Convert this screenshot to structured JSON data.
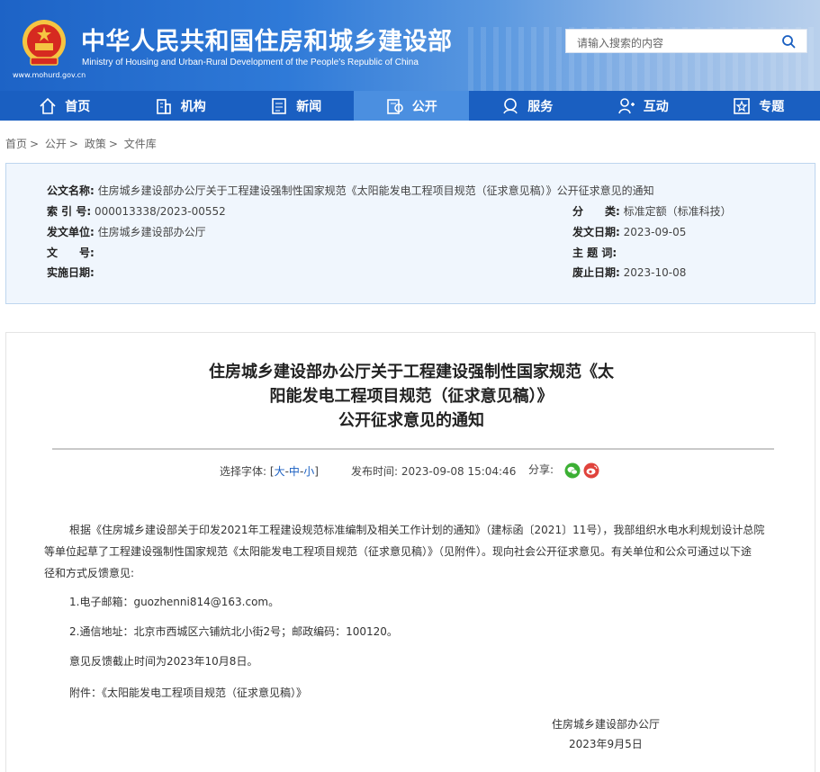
{
  "header": {
    "site_title": "中华人民共和国住房和城乡建设部",
    "site_subtitle": "Ministry of Housing and Urban-Rural Development of the People’s Republic of China",
    "site_url": "www.mohurd.gov.cn",
    "search_placeholder": "请输入搜索的内容"
  },
  "nav": {
    "items": [
      {
        "label": "首页",
        "icon": "home-icon"
      },
      {
        "label": "机构",
        "icon": "building-icon"
      },
      {
        "label": "新闻",
        "icon": "news-icon"
      },
      {
        "label": "公开",
        "icon": "open-icon"
      },
      {
        "label": "服务",
        "icon": "service-icon"
      },
      {
        "label": "互动",
        "icon": "interact-icon"
      },
      {
        "label": "专题",
        "icon": "topic-icon"
      }
    ],
    "active": "公开"
  },
  "breadcrumb": [
    "首页",
    "公开",
    "政策",
    "文件库"
  ],
  "meta": {
    "doc_name_label": "公文名称:",
    "doc_name": "住房城乡建设部办公厅关于工程建设强制性国家规范《太阳能发电工程项目规范（征求意见稿）》公开征求意见的通知",
    "index_label": "索 引 号:",
    "index": "000013338/2023-00552",
    "category_label": "分　　类:",
    "category": "标准定额（标准科技）",
    "issuer_label": "发文单位:",
    "issuer": "住房城乡建设部办公厅",
    "issue_date_label": "发文日期:",
    "issue_date": "2023-09-05",
    "doc_no_label": "文　　号:",
    "doc_no": "",
    "keywords_label": "主 题 词:",
    "keywords": "",
    "effective_label": "实施日期:",
    "effective": "",
    "expire_label": "废止日期:",
    "expire": "2023-10-08"
  },
  "article": {
    "title_lines": [
      "住房城乡建设部办公厅关于工程建设强制性国家规范《太",
      "阳能发电工程项目规范（征求意见稿）》",
      "公开征求意见的通知"
    ],
    "font_select_label": "选择字体:",
    "font_open": "[",
    "font_large": "大",
    "font_medium": "中",
    "font_small": "小",
    "font_sep": "-",
    "font_close": "]",
    "publish_label": "发布时间:",
    "publish_time": "2023-09-08 15:04:46",
    "share_label": "分享:",
    "paragraphs": [
      "根据《住房城乡建设部关于印发2021年工程建设规范标准编制及相关工作计划的通知》（建标函〔2021〕11号），我部组织水电水利规划设计总院",
      "等单位起草了工程建设强制性国家规范《太阳能发电工程项目规范（征求意见稿）》（见附件）。现向社会公开征求意见。有关单位和公众可通过以下途",
      "径和方式反馈意见:"
    ],
    "item1": "1.电子邮箱：guozhenni814@163.com。",
    "item2": "2.通信地址：北京市西城区六铺炕北小街2号；邮政编码：100120。",
    "deadline": "意见反馈截止时间为2023年10月8日。",
    "attachment": "附件：《太阳能发电工程项目规范（征求意见稿）》",
    "signature_org": "住房城乡建设部办公厅",
    "signature_date": "2023年9月5日"
  },
  "colors": {
    "nav_bg": "#1a5fc1",
    "nav_active": "#4b8fe0",
    "meta_bg": "#f0f6fd",
    "link": "#1a5fc1",
    "wechat": "#3cb034",
    "weibo": "#e0433c"
  }
}
